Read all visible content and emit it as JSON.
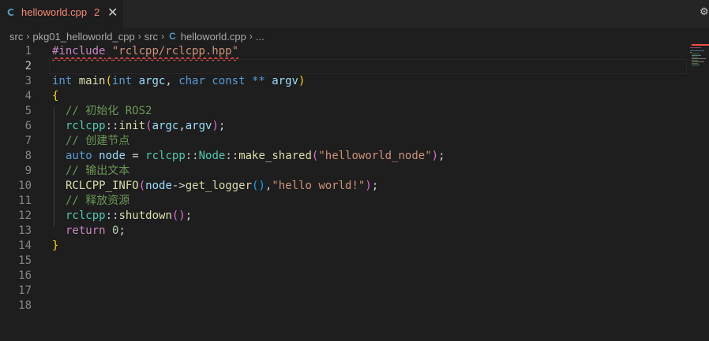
{
  "tab": {
    "icon": "C",
    "filename": "helloworld.cpp",
    "problems": "2",
    "close": "✕"
  },
  "tabbar_action_icon": "⚙",
  "breadcrumb": {
    "items": [
      "src",
      "pkg01_helloworld_cpp",
      "src"
    ],
    "file_icon": "C",
    "file": "helloworld.cpp",
    "more": "..."
  },
  "editor": {
    "line_numbers": [
      "1",
      "2",
      "3",
      "4",
      "5",
      "6",
      "7",
      "8",
      "9",
      "10",
      "11",
      "12",
      "13",
      "14",
      "15",
      "16",
      "17",
      "18"
    ],
    "active_line": 2,
    "lines": {
      "l1": {
        "kw": "#include",
        "str": "\"rclcpp/rclcpp.hpp\""
      },
      "l3": {
        "t1": "int",
        "fn": "main",
        "p1": "int",
        "a1": "argc",
        "p2": "char",
        "p3": "const",
        "op": "**",
        "a2": "argv"
      },
      "l4": {
        "brace": "{"
      },
      "l5": {
        "comment": "// 初始化 ROS2"
      },
      "l6": {
        "ns": "rclcpp",
        "fn": "init",
        "a1": "argc",
        "a2": "argv"
      },
      "l7": {
        "comment": "// 创建节点"
      },
      "l8": {
        "auto": "auto",
        "var": "node",
        "ns": "rclcpp",
        "cls": "Node",
        "fn": "make_shared",
        "str": "\"helloworld_node\""
      },
      "l9": {
        "comment": "// 输出文本"
      },
      "l10": {
        "macro": "RCLCPP_INFO",
        "var": "node",
        "fn": "get_logger",
        "str": "\"hello world!\""
      },
      "l11": {
        "comment": "// 释放资源"
      },
      "l12": {
        "ns": "rclcpp",
        "fn": "shutdown"
      },
      "l13": {
        "kw": "return",
        "num": "0"
      },
      "l14": {
        "brace": "}"
      }
    }
  },
  "colors": {
    "tab_error": "#f48771",
    "keyword": "#569cd6",
    "string": "#ce9178",
    "comment": "#6a9955",
    "function": "#dcdcaa",
    "variable": "#9cdcfe",
    "type": "#4ec9b0"
  }
}
